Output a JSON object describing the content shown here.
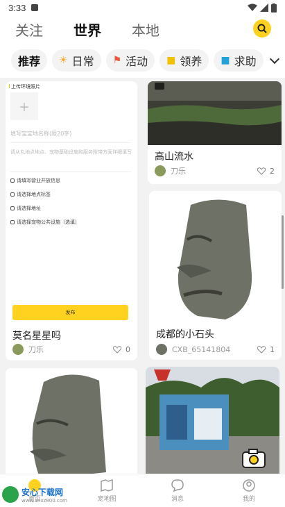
{
  "status": {
    "time": "3:33"
  },
  "top_tabs": [
    {
      "label": "关注",
      "active": false
    },
    {
      "label": "世界",
      "active": true
    },
    {
      "label": "本地",
      "active": false
    }
  ],
  "categories": [
    {
      "label": "推荐",
      "icon": "",
      "active": true
    },
    {
      "label": "日常",
      "icon": "sun-icon"
    },
    {
      "label": "活动",
      "icon": "flag-icon"
    },
    {
      "label": "领养",
      "icon": "cat-icon"
    },
    {
      "label": "求助",
      "icon": "help-icon"
    }
  ],
  "form_card": {
    "section_label": "上传环境照片",
    "name_placeholder": "填写宝宝地名称(限20字)",
    "desc_placeholder": "请从丸地点地点、宠物基础设施和服务附带方面详细填写",
    "info_items": [
      "请填写营业开放信息",
      "请选择地点标签",
      "请选择地址",
      "请选择宠物公共设施（选填）"
    ],
    "publish_label": "发布",
    "title": "莫名星星吗",
    "author": "刀乐",
    "likes": "0"
  },
  "card_mountain": {
    "title": "高山流水",
    "author": "刀乐",
    "likes": "2"
  },
  "card_stone": {
    "title": "成都的小石头",
    "author": "CXB_65141804",
    "likes": "1"
  },
  "bottom_nav": [
    {
      "label": "首页",
      "icon": "home-icon"
    },
    {
      "label": "宠地图",
      "icon": "map-icon"
    },
    {
      "label": "消息",
      "icon": "message-icon"
    },
    {
      "label": "我的",
      "icon": "profile-icon"
    }
  ],
  "watermark": {
    "title": "安心下载网",
    "url": "www.anxz800.com",
    "logo_text": "安心 下载"
  },
  "colors": {
    "accent": "#ffd21f",
    "background": "#f2f2f2"
  }
}
